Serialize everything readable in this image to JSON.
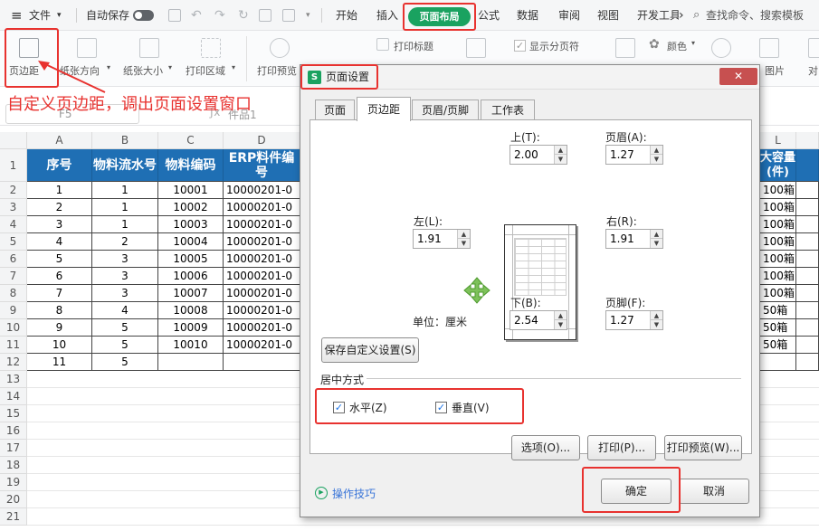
{
  "menubar": {
    "file": "文件",
    "autosave": "自动保存",
    "tabs": [
      "开始",
      "插入",
      "页面布局",
      "公式",
      "数据",
      "审阅",
      "视图",
      "开发工具"
    ],
    "more": "›",
    "search": "查找命令、搜索模板"
  },
  "ribbon": {
    "margins": "页边距",
    "orientation": "纸张方向",
    "size": "纸张大小",
    "print_area": "打印区域",
    "print_preview": "打印预览",
    "print_titles": "打印标题",
    "show_page_breaks": "显示分页符",
    "colors": "颜色",
    "bg_image": "图片",
    "align": "对"
  },
  "annotation": {
    "text": "自定义页边距，调出页面设置窗口"
  },
  "formula_bar": {
    "name_box": "F5",
    "formula_value": "件品1"
  },
  "sheet": {
    "columns": [
      "A",
      "B",
      "C",
      "D",
      "L"
    ],
    "headers": {
      "a": "序号",
      "b": "物料流水号",
      "c": "物料编码",
      "d": "ERP料件编号",
      "l": "大容量(件)"
    },
    "row_numbers": [
      "1",
      "2",
      "3",
      "4",
      "5",
      "6",
      "7",
      "8",
      "9",
      "10",
      "11",
      "12",
      "13",
      "14",
      "15",
      "16",
      "17",
      "18",
      "19",
      "20",
      "21"
    ],
    "rows": [
      {
        "a": "1",
        "b": "1",
        "c": "10001",
        "d": "10000201-0",
        "l": "100箱"
      },
      {
        "a": "2",
        "b": "1",
        "c": "10002",
        "d": "10000201-0",
        "l": "100箱"
      },
      {
        "a": "3",
        "b": "1",
        "c": "10003",
        "d": "10000201-0",
        "l": "100箱"
      },
      {
        "a": "4",
        "b": "2",
        "c": "10004",
        "d": "10000201-0",
        "l": "100箱"
      },
      {
        "a": "5",
        "b": "3",
        "c": "10005",
        "d": "10000201-0",
        "l": "100箱"
      },
      {
        "a": "6",
        "b": "3",
        "c": "10006",
        "d": "10000201-0",
        "l": "100箱"
      },
      {
        "a": "7",
        "b": "3",
        "c": "10007",
        "d": "10000201-0",
        "l": "100箱"
      },
      {
        "a": "8",
        "b": "4",
        "c": "10008",
        "d": "10000201-0",
        "l": "50箱"
      },
      {
        "a": "9",
        "b": "5",
        "c": "10009",
        "d": "10000201-0",
        "l": "50箱"
      },
      {
        "a": "10",
        "b": "5",
        "c": "10010",
        "d": "10000201-0",
        "l": "50箱"
      },
      {
        "a": "11",
        "b": "5",
        "c": "",
        "d": "",
        "l": ""
      }
    ]
  },
  "dialog": {
    "title": "页面设置",
    "close": "✕",
    "tabs": [
      "页面",
      "页边距",
      "页眉/页脚",
      "工作表"
    ],
    "top_label": "上(T):",
    "top_value": "2.00",
    "header_label": "页眉(A):",
    "header_value": "1.27",
    "left_label": "左(L):",
    "left_value": "1.91",
    "right_label": "右(R):",
    "right_value": "1.91",
    "bottom_label": "下(B):",
    "bottom_value": "2.54",
    "footer_label": "页脚(F):",
    "footer_value": "1.27",
    "unit": "单位：厘米",
    "save_custom": "保存自定义设置(S)",
    "center_section": "居中方式",
    "horizontal": "水平(Z)",
    "vertical": "垂直(V)",
    "options": "选项(O)...",
    "print": "打印(P)...",
    "print_preview": "打印预览(W)...",
    "tips": "操作技巧",
    "ok": "确定",
    "cancel": "取消"
  }
}
